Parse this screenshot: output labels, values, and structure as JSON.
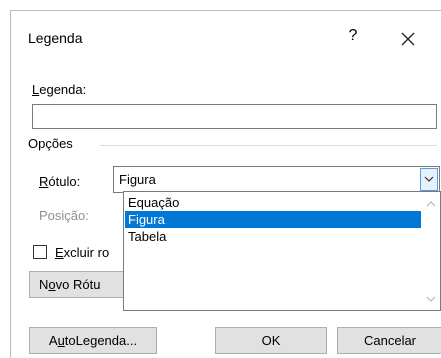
{
  "dialog": {
    "title": "Legenda",
    "help_glyph": "?",
    "close_icon": "close-icon"
  },
  "caption": {
    "label_underlined": "L",
    "label_rest": "egenda:",
    "value": ""
  },
  "options": {
    "heading": "Opções"
  },
  "label_field": {
    "label_underlined": "R",
    "label_rest": "ótulo:",
    "selected": "Figura",
    "dropdown_icon": "chevron-down-icon"
  },
  "position_field": {
    "label": "Posição:"
  },
  "exclude": {
    "checked": false,
    "label_underlined": "E",
    "label_rest": "xcluir ro"
  },
  "buttons": {
    "new_label_prefix": "N",
    "new_label_underlined": "o",
    "new_label_rest": "vo Rótu",
    "autocaption_prefix": "A",
    "autocaption_underlined": "u",
    "autocaption_rest": "toLegenda...",
    "ok": "OK",
    "cancel": "Cancelar"
  },
  "dropdown_options": [
    {
      "label": "Equação",
      "selected": false
    },
    {
      "label": "Figura",
      "selected": true
    },
    {
      "label": "Tabela",
      "selected": false
    }
  ],
  "colors": {
    "selection": "#0078d7",
    "arrow_highlight": "#e5f1fb",
    "arrow_border": "#569de5"
  }
}
